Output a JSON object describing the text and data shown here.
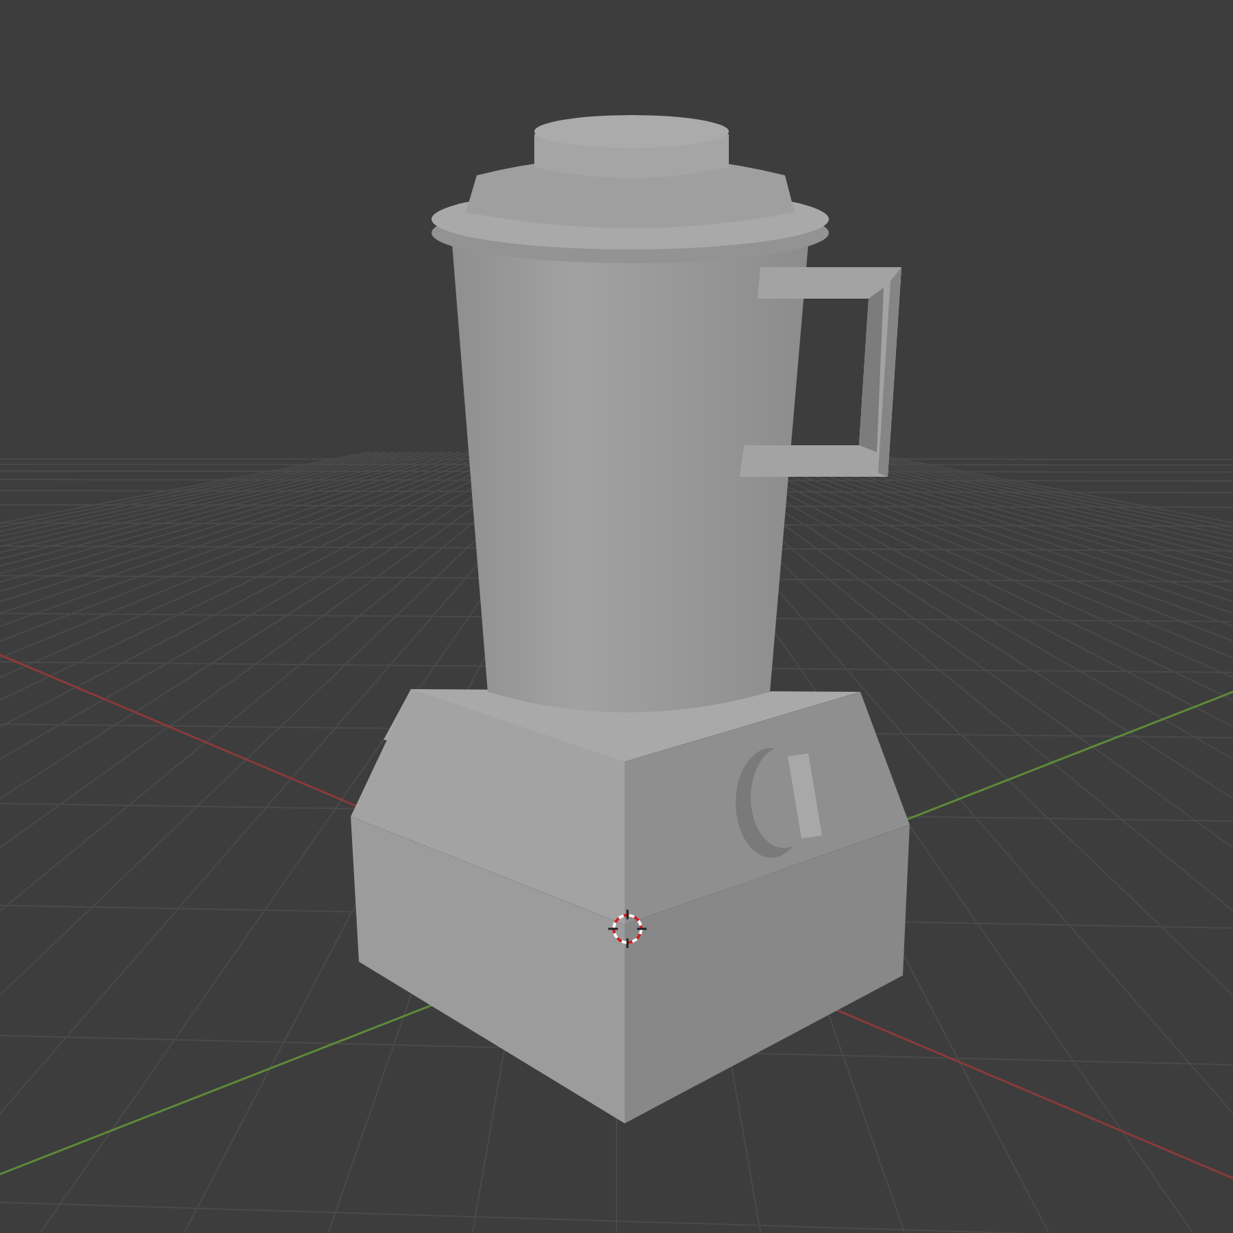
{
  "viewport": {
    "show_grid": true,
    "show_axes": true,
    "show_3d_cursor": true,
    "show_object": true
  }
}
